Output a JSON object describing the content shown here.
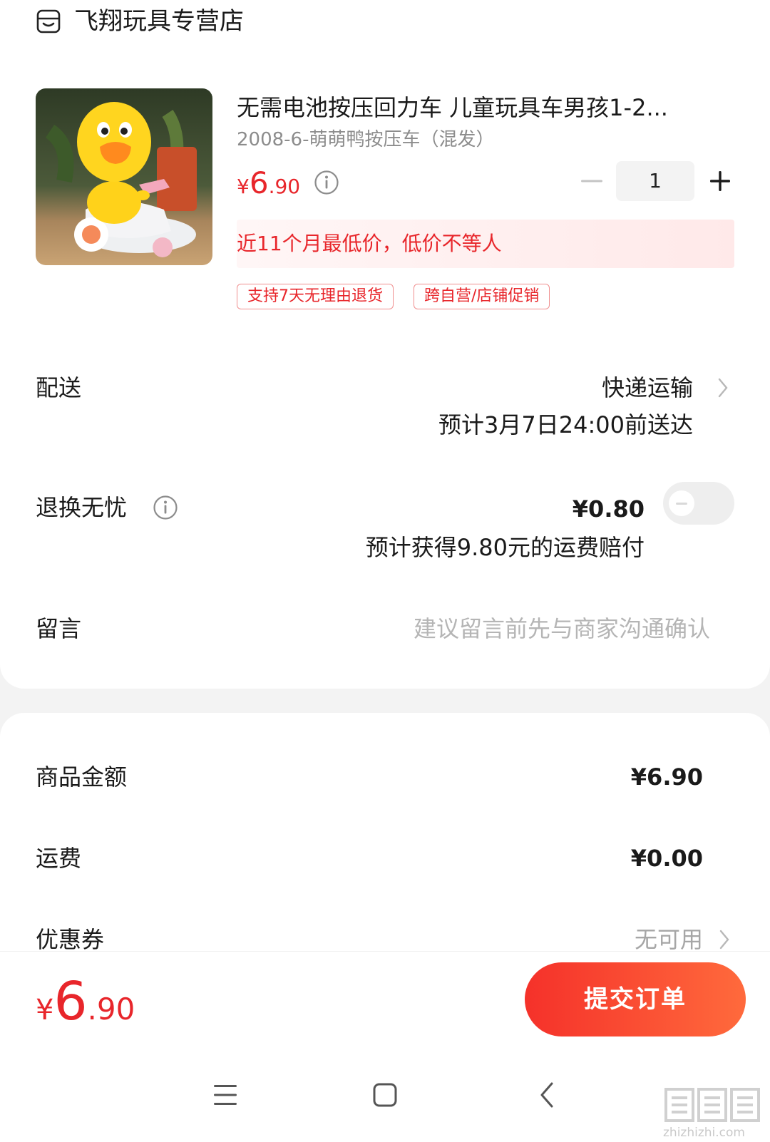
{
  "store": {
    "name": "飞翔玩具专营店",
    "icon": "store-icon"
  },
  "product": {
    "title": "无需电池按压回力车 儿童玩具车男孩1-2...",
    "spec": "2008-6-萌萌鸭按压车（混发）",
    "price": {
      "currency": "¥",
      "integer": "6",
      "decimal": ".90"
    },
    "quantity": "1",
    "banner": "近11个月最低价，低价不等人",
    "tags": [
      "支持7天无理由退货",
      "跨自营/店铺促销"
    ]
  },
  "delivery": {
    "label": "配送",
    "method": "快递运输",
    "estimate": "预计3月7日24:00前送达"
  },
  "return_insurance": {
    "label": "退换无忧",
    "price": "¥0.80",
    "note": "预计获得9.80元的运费赔付",
    "enabled": false
  },
  "message": {
    "label": "留言",
    "placeholder": "建议留言前先与商家沟通确认"
  },
  "summary": {
    "goods_label": "商品金额",
    "goods_value": "¥6.90",
    "shipping_label": "运费",
    "shipping_value": "¥0.00",
    "coupon_label": "优惠券",
    "coupon_value": "无可用"
  },
  "footer": {
    "total": {
      "currency": "¥",
      "integer": "6",
      "decimal": ".90"
    },
    "submit_label": "提交订单"
  },
  "watermark": "zhizhizhi.com",
  "colors": {
    "accent": "#e8262b",
    "button_start": "#f5312a",
    "button_end": "#ff6a3c"
  }
}
